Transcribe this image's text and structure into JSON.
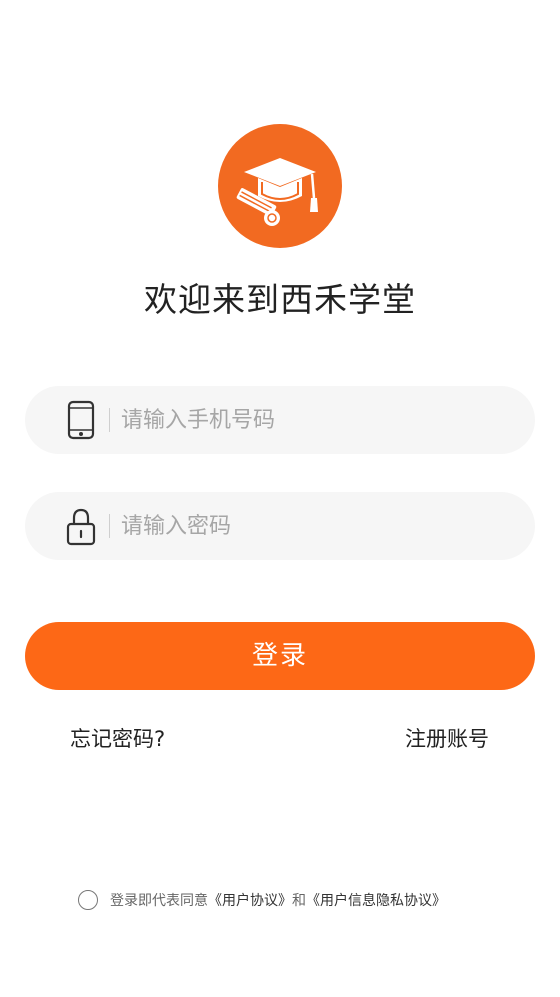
{
  "brand": {
    "welcome_title": "欢迎来到西禾学堂",
    "accent_color": "#f26a21",
    "logo_icon": "graduation-cap-diploma-icon"
  },
  "form": {
    "phone": {
      "icon": "phone-icon",
      "placeholder": "请输入手机号码",
      "value": ""
    },
    "password": {
      "icon": "lock-icon",
      "placeholder": "请输入密码",
      "value": ""
    },
    "login_label": "登录",
    "login_color": "#fd6816"
  },
  "links": {
    "forgot_password": "忘记密码?",
    "register": "注册账号"
  },
  "agreement": {
    "checked": false,
    "prefix": "登录即代表同意",
    "user_agreement": "《用户协议》",
    "conjunction": "和",
    "privacy_agreement": "《用户信息隐私协议》"
  }
}
